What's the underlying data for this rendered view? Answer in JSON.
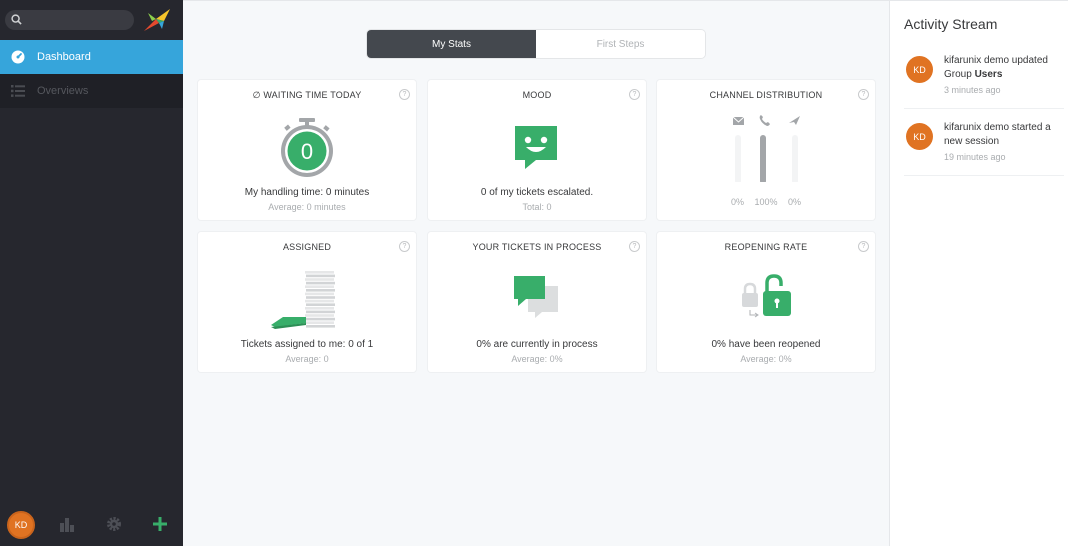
{
  "sidebar": {
    "search": {
      "value": "",
      "placeholder": ""
    },
    "nav": [
      {
        "label": "Dashboard",
        "icon": "dashboard-icon",
        "active": true
      },
      {
        "label": "Overviews",
        "icon": "list-icon",
        "active": false
      }
    ],
    "bottom": {
      "avatar_initials": "KD",
      "icons": [
        "stats-icon",
        "gear-icon",
        "plus-icon"
      ]
    }
  },
  "tabs": [
    {
      "label": "My Stats",
      "active": true
    },
    {
      "label": "First Steps",
      "active": false
    }
  ],
  "cards": {
    "waiting_time": {
      "title": "WAITING TIME TODAY",
      "title_prefix": "∅",
      "value": "0",
      "main": "My handling time: 0 minutes",
      "sub": "Average: 0 minutes"
    },
    "mood": {
      "title": "MOOD",
      "main": "0 of my tickets escalated.",
      "sub": "Total: 0"
    },
    "channel": {
      "title": "CHANNEL DISTRIBUTION",
      "channels": [
        {
          "icon": "email-icon",
          "percent": "0%",
          "fraction": 0
        },
        {
          "icon": "phone-icon",
          "percent": "100%",
          "fraction": 1
        },
        {
          "icon": "send-icon",
          "percent": "0%",
          "fraction": 0
        }
      ]
    },
    "assigned": {
      "title": "ASSIGNED",
      "main": "Tickets assigned to me: 0 of 1",
      "sub": "Average: 0"
    },
    "in_process": {
      "title": "YOUR TICKETS IN PROCESS",
      "main": "0% are currently in process",
      "sub": "Average: 0%"
    },
    "reopening": {
      "title": "REOPENING RATE",
      "main": "0% have been reopened",
      "sub": "Average: 0%"
    },
    "help_glyph": "?"
  },
  "activity": {
    "title": "Activity Stream",
    "items": [
      {
        "initials": "KD",
        "text": "kifarunix demo updated Group",
        "bold": "Users",
        "time": "3 minutes ago"
      },
      {
        "initials": "KD",
        "text": "kifarunix demo started a new session",
        "bold": "",
        "time": "19 minutes ago"
      }
    ]
  },
  "colors": {
    "accent": "#36a5db",
    "green": "#38ae6a",
    "avatar": "#e07322",
    "sidebar": "#26272e"
  }
}
